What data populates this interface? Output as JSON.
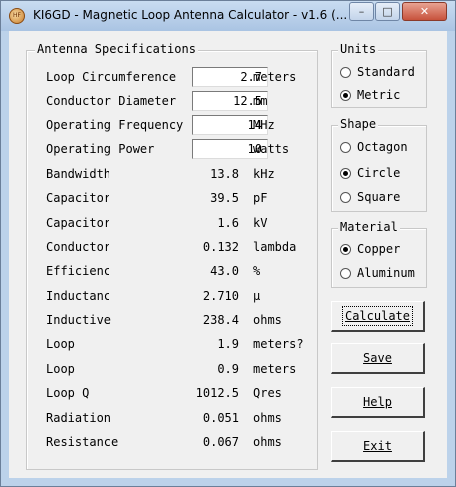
{
  "window": {
    "title": "KI6GD - Magnetic Loop Antenna Calculator - v1.6  (...",
    "icon_label": "HF",
    "caption_buttons": {
      "minimize": "–",
      "maximize": "□",
      "close": "✕"
    }
  },
  "antenna_specs": {
    "title": "Antenna Specifications",
    "inputs": [
      {
        "label": "Loop Circumference",
        "value": "2.7",
        "unit": "meters"
      },
      {
        "label": "Conductor Diameter",
        "value": "12.5",
        "unit": "mm"
      },
      {
        "label": "Operating Frequency",
        "value": "14",
        "unit": "MHz"
      },
      {
        "label": "Operating Power",
        "value": "10",
        "unit": "watts"
      }
    ],
    "results": [
      {
        "label": "Bandwidth",
        "value": "13.8",
        "unit": "kHz"
      },
      {
        "label": "Capacitor",
        "value": "39.5",
        "unit": "pF"
      },
      {
        "label": "Capacitor",
        "value": "1.6",
        "unit": "kV"
      },
      {
        "label": "Conductor",
        "value": "0.132",
        "unit": "lambda"
      },
      {
        "label": "Efficiency",
        "value": "43.0",
        "unit": "%"
      },
      {
        "label": "Inductance",
        "value": "2.710",
        "unit": "µ"
      },
      {
        "label": "Inductive",
        "value": "238.4",
        "unit": "ohms"
      },
      {
        "label": "Loop",
        "value": "1.9",
        "unit": "meters?"
      },
      {
        "label": "Loop",
        "value": "0.9",
        "unit": "meters"
      },
      {
        "label": "Loop Q",
        "value": "1012.5",
        "unit": "Qres"
      },
      {
        "label": "Radiation",
        "value": "0.051",
        "unit": "ohms"
      },
      {
        "label": "Resistance",
        "value": "0.067",
        "unit": "ohms"
      }
    ]
  },
  "units": {
    "title": "Units",
    "options": [
      {
        "label": "Standard",
        "selected": false
      },
      {
        "label": "Metric",
        "selected": true
      }
    ]
  },
  "shape": {
    "title": "Shape",
    "options": [
      {
        "label": "Octagon",
        "selected": false
      },
      {
        "label": "Circle",
        "selected": true
      },
      {
        "label": "Square",
        "selected": false
      }
    ]
  },
  "material": {
    "title": "Material",
    "options": [
      {
        "label": "Copper",
        "selected": true
      },
      {
        "label": "Aluminum",
        "selected": false
      }
    ]
  },
  "buttons": {
    "calculate": "Calculate",
    "save": "Save",
    "help": "Help",
    "exit": "Exit"
  }
}
